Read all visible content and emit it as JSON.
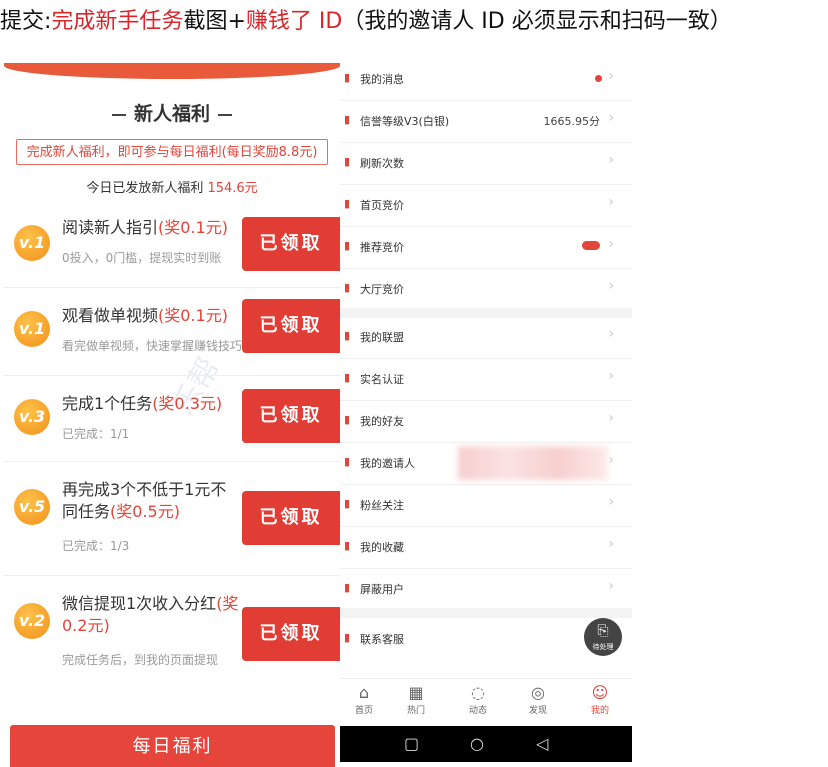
{
  "header": {
    "prefix": "提交:",
    "highlight1": "完成新手任务",
    "mid": "截图+",
    "highlight2": "赚钱了 ID",
    "suffix": "（我的邀请人 ID 必须显示和扫码一致）"
  },
  "welfare_panel": {
    "heading": "新人福利",
    "notice": "完成新人福利，即可参与每日福利(每日奖励8.8元)",
    "issued_label": "今日已发放新人福利",
    "issued_amount": "154.6元",
    "watermark": "乐帮",
    "tasks": [
      {
        "badge": "v.1",
        "title": "阅读新人指引",
        "reward": "(奖0.1元)",
        "sub": "0投入，0门槛，提现实时到账",
        "button": "已领取"
      },
      {
        "badge": "v.1",
        "title": "观看做单视频",
        "reward": "(奖0.1元)",
        "sub": "看完做单视频，快速掌握赚钱技巧",
        "button": "已领取"
      },
      {
        "badge": "v.3",
        "title": "完成1个任务",
        "reward": "(奖0.3元)",
        "sub": "已完成：1/1",
        "button": "已领取"
      },
      {
        "badge": "v.5",
        "title": "再完成3个不低于1元不同任务",
        "reward": "(奖0.5元)",
        "sub": "已完成：1/3",
        "button": "已领取"
      },
      {
        "badge": "v.2",
        "title": "微信提现1次收入分红",
        "reward": "(奖0.2元)",
        "sub": "完成任务后，到我的页面提现",
        "button": "已领取"
      }
    ],
    "daily_button": "每日福利"
  },
  "profile_menu": {
    "group1": [
      {
        "label": "我的消息",
        "value": "",
        "marker": "dot",
        "icon": "bell-icon"
      },
      {
        "label": "信誉等级V3(白银)",
        "value": "1665.95分",
        "marker": "",
        "icon": "medal-icon"
      },
      {
        "label": "刷新次数",
        "value": "",
        "marker": "",
        "icon": "refresh-icon"
      },
      {
        "label": "首页竞价",
        "value": "",
        "marker": "",
        "icon": "bid-icon"
      },
      {
        "label": "推荐竞价",
        "value": "",
        "marker": "new",
        "icon": "recommend-icon"
      },
      {
        "label": "大厅竞价",
        "value": "",
        "marker": "",
        "icon": "hall-icon"
      }
    ],
    "group2": [
      {
        "label": "我的联盟",
        "value": "",
        "marker": "",
        "icon": "alliance-icon"
      },
      {
        "label": "实名认证",
        "value": "",
        "marker": "",
        "icon": "id-card-icon"
      },
      {
        "label": "我的好友",
        "value": "",
        "marker": "",
        "icon": "friends-icon"
      },
      {
        "label": "我的邀请人",
        "value": "",
        "marker": "",
        "icon": "inviter-icon"
      },
      {
        "label": "粉丝关注",
        "value": "",
        "marker": "",
        "icon": "fans-icon"
      },
      {
        "label": "我的收藏",
        "value": "",
        "marker": "",
        "icon": "favorite-icon"
      },
      {
        "label": "屏蔽用户",
        "value": "",
        "marker": "",
        "icon": "block-icon"
      }
    ],
    "group3": [
      {
        "label": "联系客服",
        "value": "",
        "marker": "",
        "icon": "service-icon"
      }
    ],
    "fab_label": "待处理",
    "tabs": [
      {
        "label": "首页",
        "icon": "home-icon",
        "glyph": "⌂"
      },
      {
        "label": "热门",
        "icon": "hot-icon",
        "glyph": "▦"
      },
      {
        "label": "动态",
        "icon": "feed-icon",
        "glyph": "◌"
      },
      {
        "label": "发现",
        "icon": "discover-icon",
        "glyph": "◎"
      },
      {
        "label": "我的",
        "icon": "profile-icon",
        "glyph": "☺"
      }
    ],
    "active_tab": "我的"
  }
}
